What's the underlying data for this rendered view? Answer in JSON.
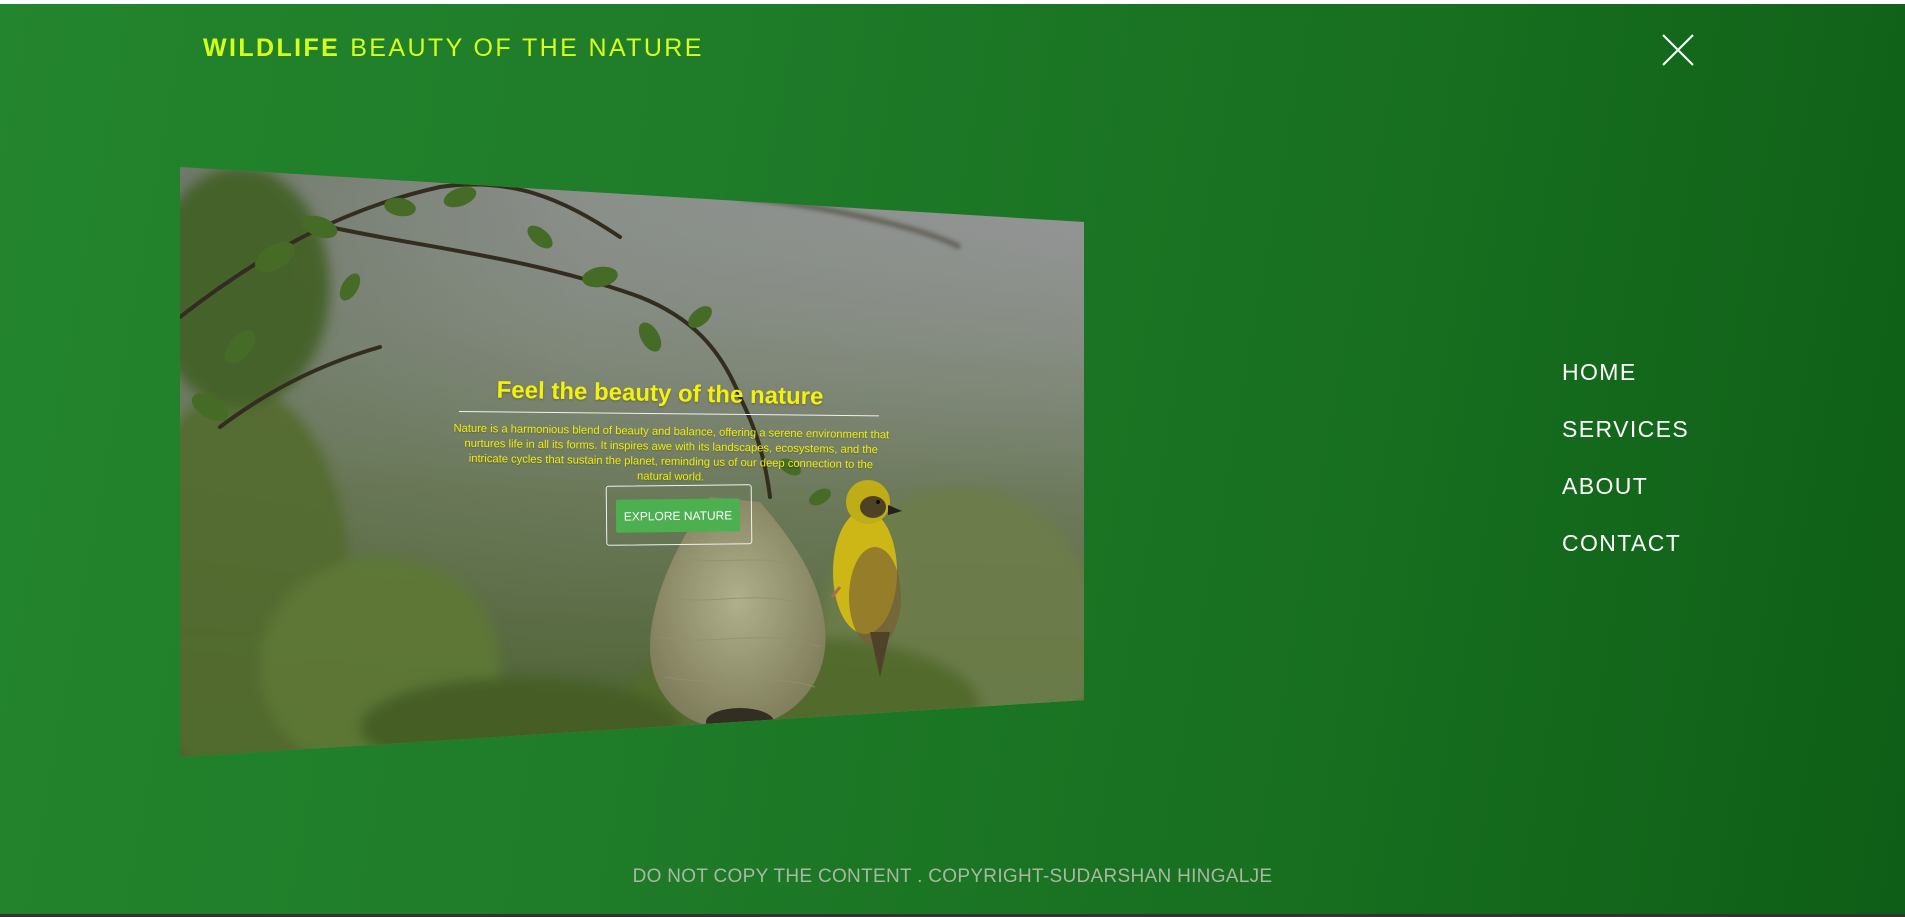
{
  "header": {
    "brand_strong": "WILDLIFE",
    "brand_rest": "BEAUTY OF THE NATURE",
    "close_icon": "close-icon"
  },
  "menu": {
    "items": [
      {
        "label": "HOME"
      },
      {
        "label": "SERVICES"
      },
      {
        "label": "ABOUT"
      },
      {
        "label": "CONTACT"
      }
    ]
  },
  "hero": {
    "title": "Feel the beauty of the nature",
    "description": "Nature is a harmonious blend of beauty and balance, offering a serene environment that nurtures life in all its forms. It inspires awe with its landscapes, ecosystems, and the intricate cycles that sustain the planet, reminding us of our deep connection to the natural world.",
    "button_label": "EXPLORE NATURE"
  },
  "footer": {
    "copyright": "DO NOT COPY THE CONTENT . COPYRIGHT-SUDARSHAN HINGALJE"
  },
  "colors": {
    "background_green": "#1f7c29",
    "brand_yellow": "#d6ff1e",
    "hero_text_yellow": "#f4f10b",
    "button_green": "#4caf50"
  }
}
